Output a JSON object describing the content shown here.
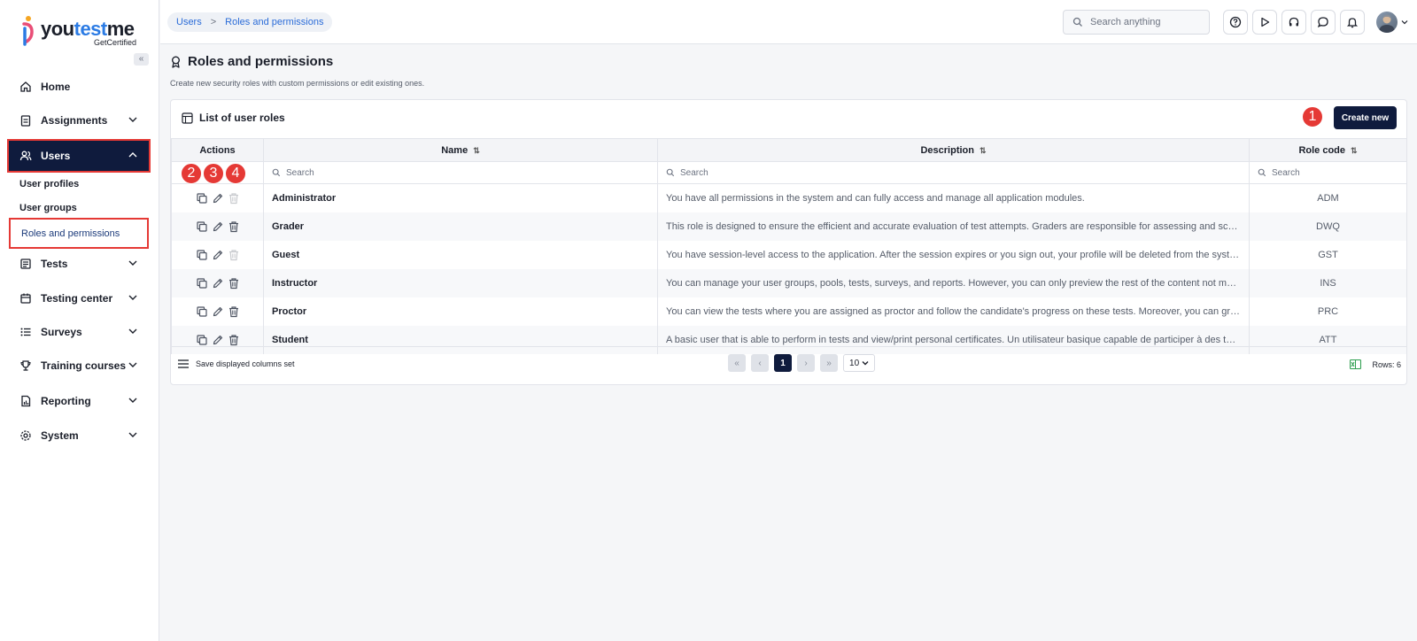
{
  "logo": {
    "text_a": "you",
    "text_b": "test",
    "text_c": "me",
    "sub": "GetCertified"
  },
  "sidebar": {
    "collapse_icon": "«",
    "items": [
      {
        "label": "Home",
        "icon": "home-icon"
      },
      {
        "label": "Assignments",
        "icon": "clipboard-icon"
      },
      {
        "label": "Users",
        "icon": "users-icon"
      },
      {
        "label": "Tests",
        "icon": "tests-icon"
      },
      {
        "label": "Testing center",
        "icon": "testing-center-icon"
      },
      {
        "label": "Surveys",
        "icon": "list-icon"
      },
      {
        "label": "Training courses",
        "icon": "trophy-icon"
      },
      {
        "label": "Reporting",
        "icon": "report-icon"
      },
      {
        "label": "System",
        "icon": "gear-icon"
      }
    ],
    "users_sub": [
      "User profiles",
      "User groups",
      "Roles and permissions"
    ]
  },
  "topbar": {
    "breadcrumb": [
      "Users",
      "Roles and permissions"
    ],
    "breadcrumb_sep": ">",
    "search_placeholder": "Search anything"
  },
  "page": {
    "title": "Roles and permissions",
    "subtitle": "Create new security roles with custom permissions or edit existing ones."
  },
  "card": {
    "title": "List of user roles",
    "create_label": "Create new",
    "badges": [
      "1",
      "2",
      "3",
      "4"
    ]
  },
  "table": {
    "headers": {
      "actions": "Actions",
      "name": "Name",
      "description": "Description",
      "code": "Role code"
    },
    "filter_placeholder": "Search",
    "rows": [
      {
        "name": "Administrator",
        "description": "You have all permissions in the system and can fully access and manage all application modules.",
        "code": "ADM",
        "delete_enabled": false
      },
      {
        "name": "Grader",
        "description": "This role is designed to ensure the efficient and accurate evaluation of test attempts. Graders are responsible for assessing and scoring tes...",
        "code": "DWQ",
        "delete_enabled": true
      },
      {
        "name": "Guest",
        "description": "You have session-level access to the application. After the session expires or you sign out, your profile will be deleted from the system. You...",
        "code": "GST",
        "delete_enabled": false
      },
      {
        "name": "Instructor",
        "description": "You can manage your user groups, pools, tests, surveys, and reports. However, you can only preview the rest of the content not managed b...",
        "code": "INS",
        "delete_enabled": true
      },
      {
        "name": "Proctor",
        "description": "You can view the tests where you are assigned as proctor and follow the candidate's progress on these tests. Moreover, you can grade the ...",
        "code": "PRC",
        "delete_enabled": true
      },
      {
        "name": "Student",
        "description": "A basic user that is able to perform in tests and view/print personal certificates. Un utilisateur basique capable de participer à des tests et d...",
        "code": "ATT",
        "delete_enabled": true
      }
    ]
  },
  "footer": {
    "save_label": "Save displayed columns set",
    "page": "1",
    "page_size": "10",
    "rows_label": "Rows: 6"
  },
  "colors": {
    "accent": "#0f1b3d",
    "highlight": "#e53935",
    "link": "#2b6cd8"
  }
}
